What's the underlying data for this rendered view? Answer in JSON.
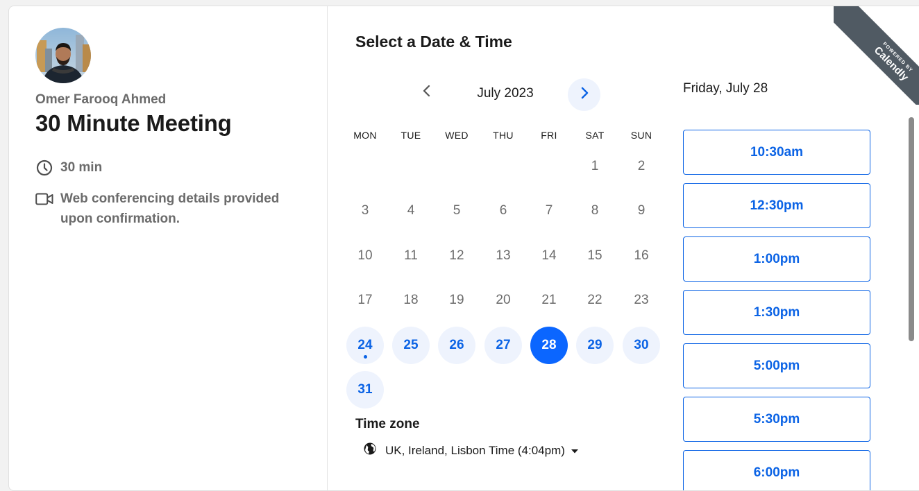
{
  "organizer": {
    "name": "Omer Farooq Ahmed"
  },
  "event": {
    "title": "30 Minute Meeting",
    "duration": "30 min",
    "location_line1": "Web conferencing details provided",
    "location_line2": "upon confirmation."
  },
  "scheduler": {
    "title": "Select a Date & Time",
    "month": "July 2023",
    "weekdays": [
      "MON",
      "TUE",
      "WED",
      "THU",
      "FRI",
      "SAT",
      "SUN"
    ],
    "days": [
      {
        "n": "1"
      },
      {
        "n": "2"
      },
      {
        "n": "3"
      },
      {
        "n": "4"
      },
      {
        "n": "5"
      },
      {
        "n": "6"
      },
      {
        "n": "7"
      },
      {
        "n": "8"
      },
      {
        "n": "9"
      },
      {
        "n": "10"
      },
      {
        "n": "11"
      },
      {
        "n": "12"
      },
      {
        "n": "13"
      },
      {
        "n": "14"
      },
      {
        "n": "15"
      },
      {
        "n": "16"
      },
      {
        "n": "17"
      },
      {
        "n": "18"
      },
      {
        "n": "19"
      },
      {
        "n": "20"
      },
      {
        "n": "21"
      },
      {
        "n": "22"
      },
      {
        "n": "23"
      },
      {
        "n": "24"
      },
      {
        "n": "25"
      },
      {
        "n": "26"
      },
      {
        "n": "27"
      },
      {
        "n": "28"
      },
      {
        "n": "29"
      },
      {
        "n": "30"
      },
      {
        "n": "31"
      }
    ],
    "available_days": [
      "24",
      "25",
      "26",
      "27",
      "28",
      "29",
      "30",
      "31"
    ],
    "selected_day": "28",
    "today": "24"
  },
  "timezone": {
    "label": "Time zone",
    "value": "UK, Ireland, Lisbon Time (4:04pm)"
  },
  "times": {
    "date_heading": "Friday, July 28",
    "slots": [
      "10:30am",
      "12:30pm",
      "1:00pm",
      "1:30pm",
      "5:00pm",
      "5:30pm",
      "6:00pm"
    ]
  },
  "badge": {
    "small": "POWERED BY",
    "big": "Calendly"
  },
  "icons": {
    "clock": "clock-icon",
    "video": "video-camera-icon",
    "globe": "globe-icon",
    "prev": "chevron-left-icon",
    "next": "chevron-right-icon",
    "caret": "caret-down-icon"
  },
  "colors": {
    "accent": "#0b66ff",
    "accent_text": "#0b63e5",
    "available_bg": "#eef3fd",
    "muted": "#6b6b6b"
  }
}
